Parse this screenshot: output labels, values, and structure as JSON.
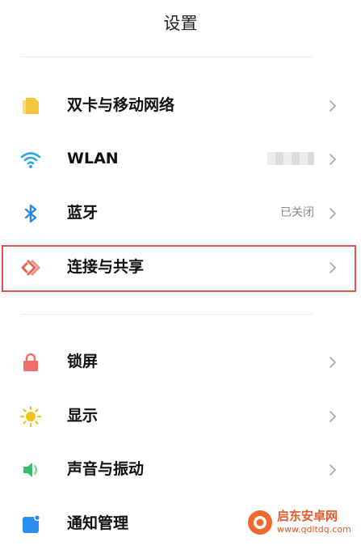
{
  "header": {
    "title": "设置"
  },
  "settings": {
    "group1": [
      {
        "label": "双卡与移动网络",
        "status": "",
        "icon": "sim-card-icon"
      },
      {
        "label": "WLAN",
        "status": "",
        "icon": "wifi-icon"
      },
      {
        "label": "蓝牙",
        "status": "已关闭",
        "icon": "bluetooth-icon"
      },
      {
        "label": "连接与共享",
        "status": "",
        "icon": "connection-share-icon"
      }
    ],
    "group2": [
      {
        "label": "锁屏",
        "status": "",
        "icon": "lock-icon"
      },
      {
        "label": "显示",
        "status": "",
        "icon": "sun-icon"
      },
      {
        "label": "声音与振动",
        "status": "",
        "icon": "speaker-icon"
      },
      {
        "label": "通知管理",
        "status": "",
        "icon": "notification-icon"
      }
    ]
  },
  "watermark": {
    "text": "启东安卓网",
    "url": "www.qdltdq.com"
  },
  "colors": {
    "sim": "#f5c542",
    "wifi": "#2ea8e8",
    "bluetooth": "#2c86e0",
    "connection": "#e8654f",
    "lock": "#f07069",
    "display": "#f3c21c",
    "sound": "#2fc46b",
    "notification": "#2a8ef0",
    "highlight": "#d9534f"
  }
}
